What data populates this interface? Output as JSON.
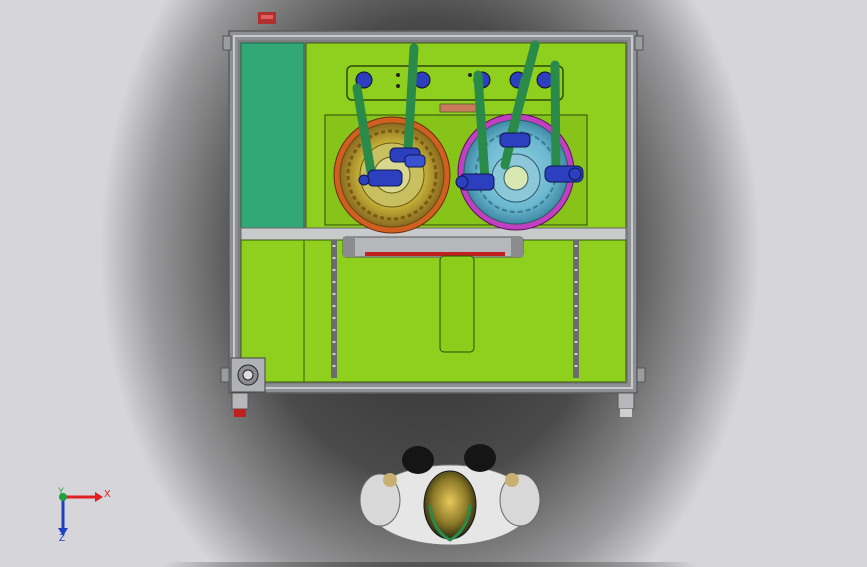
{
  "app": {
    "title": ""
  },
  "viewport": {
    "view": "top",
    "background_gradient": [
      "#2a2a2a",
      "#d6d6da"
    ]
  },
  "triad": {
    "x_label": "X",
    "y_label": "Y",
    "z_label": "Z",
    "x_color": "#e02020",
    "y_color": "#20a040",
    "z_color": "#2040c0"
  },
  "model": {
    "frame_color": "#9ea0a4",
    "panel_color": "#8fcf1d",
    "side_panel_color": "#32a877",
    "left_ring_color": "#d06020",
    "right_ring_color": "#c040c0",
    "hose_color": "#2a8a4a",
    "actuator_color": "#2b3fbf",
    "operator_icon": "human-figure-icon"
  }
}
